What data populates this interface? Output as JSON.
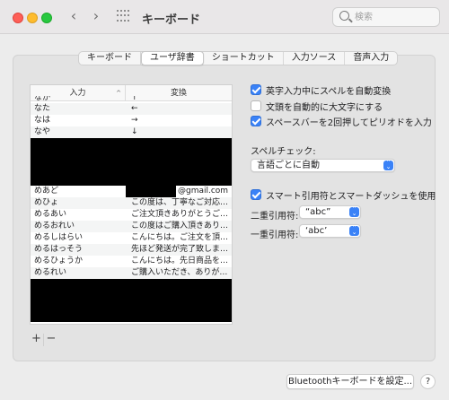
{
  "window": {
    "title": "キーボード",
    "search_placeholder": "検索",
    "nav_back": "‹",
    "nav_forward": "›"
  },
  "tabs": [
    {
      "label": "キーボード",
      "active": false
    },
    {
      "label": "ユーザ辞書",
      "active": true
    },
    {
      "label": "ショートカット",
      "active": false
    },
    {
      "label": "入力ソース",
      "active": false
    },
    {
      "label": "音声入力",
      "active": false
    }
  ],
  "table": {
    "headers": [
      "入力",
      "変換"
    ],
    "sort_indicator": "^",
    "rows_top": [
      {
        "input": "なか",
        "output": "↑"
      },
      {
        "input": "なた",
        "output": "←"
      },
      {
        "input": "なは",
        "output": "→"
      },
      {
        "input": "なや",
        "output": "↓"
      }
    ],
    "rows_middle": [
      {
        "input": "めあど",
        "output": "@gmail.com"
      },
      {
        "input": "めひょ",
        "output": "この度は、丁寧なご対応…"
      },
      {
        "input": "めるあい",
        "output": "ご注文頂きありがとうご…"
      },
      {
        "input": "めるおれい",
        "output": "この度はご購入頂きあり…"
      },
      {
        "input": "めるしはらい",
        "output": "こんにちは。ご注文を頂…"
      },
      {
        "input": "めるはっそう",
        "output": "先ほど発送が完了致しま…"
      },
      {
        "input": "めるひょうか",
        "output": "こんにちは。先日商品を…"
      },
      {
        "input": "めるれい",
        "output": "ご購入いただき、ありが…"
      }
    ],
    "add_label": "+",
    "remove_label": "−"
  },
  "options": {
    "auto_spell": {
      "label": "英字入力中にスペルを自動変換",
      "checked": true
    },
    "auto_capitalize": {
      "label": "文頭を自動的に大文字にする",
      "checked": false
    },
    "double_space_period": {
      "label": "スペースバーを2回押してピリオドを入力",
      "checked": true
    },
    "spell_check_label": "スペルチェック:",
    "spell_check_value": "言語ごとに自動",
    "smart_quotes": {
      "label": "スマート引用符とスマートダッシュを使用",
      "checked": true
    },
    "double_quote_label": "二重引用符:",
    "double_quote_value": "“abc”",
    "single_quote_label": "一重引用符:",
    "single_quote_value": "‘abc’"
  },
  "footer": {
    "bluetooth_button": "Bluetoothキーボードを設定...",
    "help_button": "?"
  },
  "colors": {
    "accent": "#3a82f7",
    "close": "#fe5f57",
    "minimize": "#febc2e",
    "maximize": "#28c840"
  }
}
